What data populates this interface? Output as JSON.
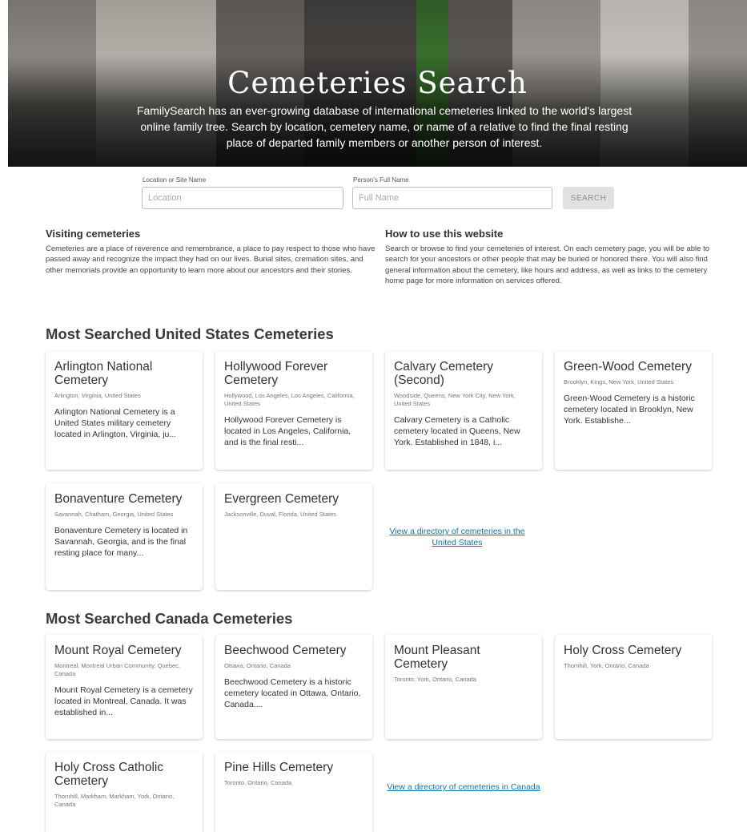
{
  "hero": {
    "title": "Cemeteries Search",
    "subtitle": "FamilySearch has an ever-growing database of international cemeteries linked to the world's largest online family tree. Search by location, cemetery name, or name of a relative to find the final resting place of departed family members or another person of interest."
  },
  "search": {
    "location_label": "Location or Site Name",
    "location_placeholder": "Location",
    "person_label": "Person's Full Name",
    "person_placeholder": "Full Name",
    "button_label": "SEARCH"
  },
  "visiting": {
    "title": "Visiting cemeteries",
    "text": "Cemeteries are a place of reverence and remembrance, a place to pay respect to those who have passed away and recognize the impact they had on our lives. Burial sites, cremation sites, and other memorials provide an opportunity to learn more about our ancestors and their stories."
  },
  "howto": {
    "title": "How to use this website",
    "text": "Search or browse to find your cemeteries of interest. On each cemetery page, you will be able to search for your ancestors or other people that may be buried or honored there. You will also find general information about the cemetery, like hours and address, as well as links to the cemetery home page for more information on services offered."
  },
  "us_section": {
    "title": "Most Searched United States Cemeteries",
    "cards": [
      {
        "name": "Arlington National Cemetery",
        "location": "Arlington, Virginia, United States",
        "description": "Arlington National Cemetery is a United States military cemetery located in Arlington, Virginia, ju..."
      },
      {
        "name": "Hollywood Forever Cemetery",
        "location": "Hollywood, Los Angeles, Los Angeles, California, United States",
        "description": "Hollywood Forever Cemetery is located in Los Angeles, California, and is the final resti..."
      },
      {
        "name": "Calvary Cemetery (Second)",
        "location": "Woodside, Queens, New York City, New York, United States",
        "description": "Calvary Cemetery is a Catholic cemetery located in Queens, New York. Established in 1848, i..."
      },
      {
        "name": "Green-Wood Cemetery",
        "location": "Brooklyn, Kings, New York, United States",
        "description": "Green-Wood Cemetery is a historic cemetery located in Brooklyn, New York. Establishe..."
      },
      {
        "name": "Bonaventure Cemetery",
        "location": "Savannah, Chatham, Georgia, United States",
        "description": "Bonaventure Cemetery is located in Savannah, Georgia, and is the final resting place for many..."
      },
      {
        "name": "Evergreen Cemetery",
        "location": "Jacksonville, Duval, Florida, United States",
        "description": ""
      }
    ],
    "directory_link": "View a directory of cemeteries in the United States"
  },
  "ca_section": {
    "title": "Most Searched Canada Cemeteries",
    "cards": [
      {
        "name": "Mount Royal Cemetery",
        "location": "Montreal, Montreal Urban Community, Quebec, Canada",
        "description": "Mount Royal Cemetery is a cemetery located in Montreal, Canada. It was established in..."
      },
      {
        "name": "Beechwood Cemetery",
        "location": "Ottawa, Ontario, Canada",
        "description": "Beechwood Cemetery is a historic cemetery located in Ottawa, Ontario, Canada...."
      },
      {
        "name": "Mount Pleasant Cemetery",
        "location": "Toronto, York, Ontario, Canada",
        "description": ""
      },
      {
        "name": "Holy Cross Cemetery",
        "location": "Thornhill, York, Ontario, Canada",
        "description": ""
      },
      {
        "name": "Holy Cross Catholic Cemetery",
        "location": "Thornhill, Markham, Markham, York, Ontario, Canada",
        "description": ""
      },
      {
        "name": "Pine Hills Cemetery",
        "location": "Toronto, Ontario, Canada",
        "description": ""
      }
    ],
    "directory_link": "View a directory of cemeteries in Canada"
  }
}
